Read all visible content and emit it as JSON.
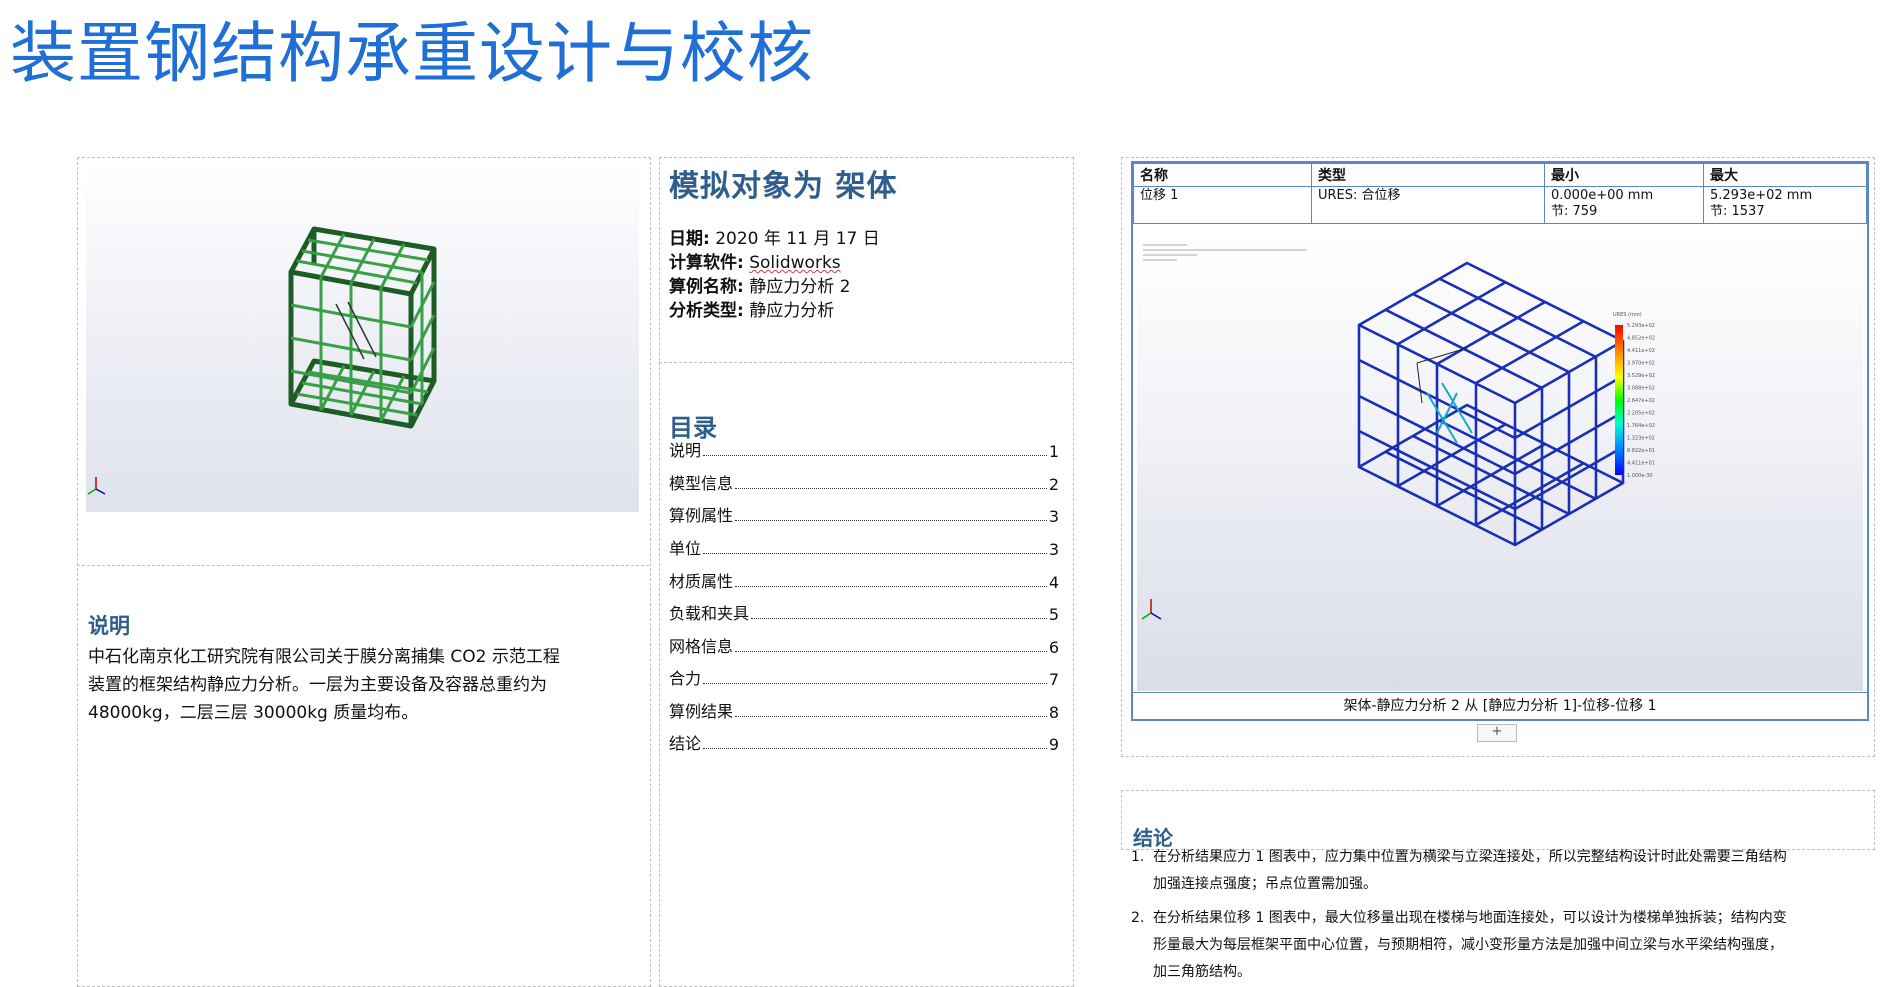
{
  "slide": {
    "title": "装置钢结构承重设计与校核"
  },
  "left_report": {
    "description_heading": "说明",
    "description_lines": [
      "中石化南京化工研究院有限公司关于膜分离捕集 CO2 示范工程",
      "装置的框架结构静应力分析。一层为主要设备及容器总重约为",
      "48000kg，二层三层 30000kg 质量均布。"
    ]
  },
  "study_info": {
    "title": "模拟对象为  架体",
    "rows": [
      {
        "label": "日期:",
        "value": "2020 年 11 月 17 日"
      },
      {
        "label": "计算软件:",
        "value": "Solidworks"
      },
      {
        "label": "算例名称:",
        "value": "静应力分析 2"
      },
      {
        "label": "分析类型:",
        "value": "静应力分析"
      }
    ]
  },
  "toc": {
    "heading": "目录",
    "items": [
      {
        "label": "说明",
        "page": "1"
      },
      {
        "label": "模型信息",
        "page": "2"
      },
      {
        "label": "算例属性",
        "page": "3"
      },
      {
        "label": "单位",
        "page": "3"
      },
      {
        "label": "材质属性",
        "page": "4"
      },
      {
        "label": "负载和夹具",
        "page": "5"
      },
      {
        "label": "网格信息",
        "page": "6"
      },
      {
        "label": "合力",
        "page": "7"
      },
      {
        "label": "算例结果",
        "page": "8"
      },
      {
        "label": "结论",
        "page": "9"
      }
    ]
  },
  "results_table": {
    "headers": [
      "名称",
      "类型",
      "最小",
      "最大"
    ],
    "row": {
      "name": "位移 1",
      "type": "URES: 合位移",
      "min_value": "0.000e+00 mm",
      "min_node": "节: 759",
      "max_value": "5.293e+02 mm",
      "max_node": "节: 1537"
    }
  },
  "plot": {
    "caption": "架体-静应力分析 2 从 [静应力分析 1]-位移-位移 1",
    "legend_title": "URES (mm)",
    "legend_values": [
      "5.293e+02",
      "4.852e+02",
      "4.411e+02",
      "3.970e+02",
      "3.529e+02",
      "3.088e+02",
      "2.647e+02",
      "2.205e+02",
      "1.764e+02",
      "1.323e+02",
      "8.822e+01",
      "4.411e+01",
      "1.000e-30"
    ],
    "frame_color": "#1a2fb5",
    "highlight_color": "#1aa6c8"
  },
  "ui": {
    "plus": "+"
  },
  "conclusion": {
    "heading": "结论",
    "items": [
      {
        "num": "1.",
        "lines": [
          "在分析结果应力 1 图表中，应力集中位置为横梁与立梁连接处，所以完整结构设计时此处需要三角结构",
          "加强连接点强度；吊点位置需加强。"
        ]
      },
      {
        "num": "2.",
        "lines": [
          "在分析结果位移 1 图表中，最大位移量出现在楼梯与地面连接处，可以设计为楼梯单独拆装；结构内变",
          "形量最大为每层框架平面中心位置，与预期相符，减小变形量方法是加强中间立梁与水平梁结构强度，",
          "加三角筋结构。"
        ]
      }
    ]
  },
  "colors": {
    "title_blue": "#1f6fd6",
    "heading_blue": "#2e5d8e",
    "model_green": "#2f8a3a",
    "table_border": "#5b87c9"
  }
}
